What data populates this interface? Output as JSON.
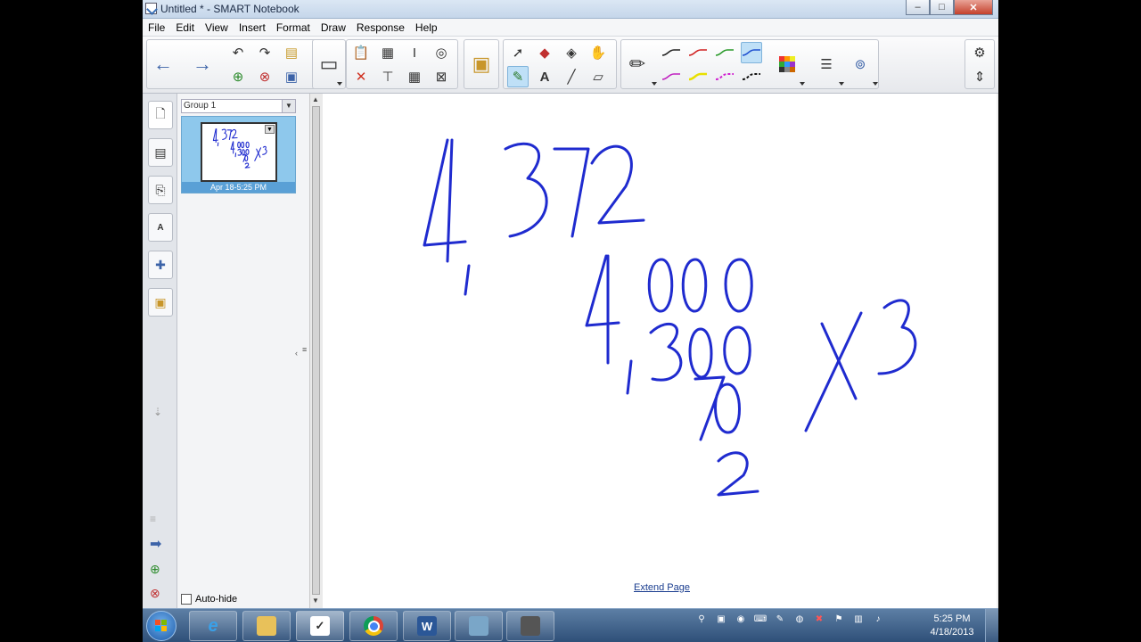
{
  "window": {
    "title": "Untitled * - SMART Notebook",
    "minimize_label": "–",
    "maximize_label": "□",
    "close_label": "✕"
  },
  "menu": [
    "File",
    "Edit",
    "View",
    "Insert",
    "Format",
    "Draw",
    "Response",
    "Help"
  ],
  "sorter": {
    "group_label": "Group 1",
    "thumbnail_caption": "Apr 18-5:25 PM",
    "autohide_label": "Auto-hide"
  },
  "canvas": {
    "extend_page_label": "Extend Page",
    "ink_color": "#1f2bcf",
    "handwritten_text": [
      "4,372",
      "4,000",
      "300",
      "70",
      "2",
      "X3"
    ]
  },
  "pen_colors": [
    "#222222",
    "#d02020",
    "#2a9a2a",
    "#1f50d0",
    "#c020c0",
    "#e8e000",
    "#d020d0",
    "#111111"
  ],
  "taskbar": {
    "clock_time": "5:25 PM",
    "clock_date": "4/18/2013"
  }
}
